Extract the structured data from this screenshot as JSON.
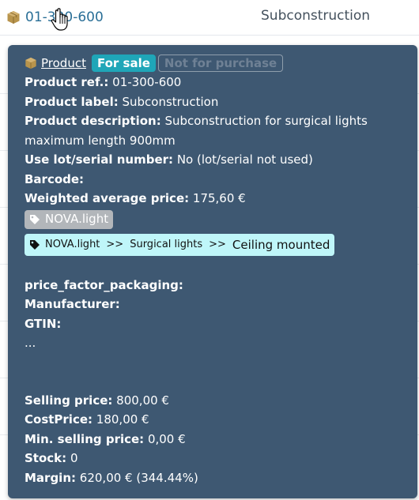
{
  "row": {
    "ref": "01-300-600",
    "label": "Subconstruction"
  },
  "tooltip": {
    "title_link": "Product",
    "badge_sale": "For sale",
    "badge_not_purchase": "Not for purchase",
    "fields": [
      {
        "k": "Product ref.:",
        "v": "01-300-600"
      },
      {
        "k": "Product label:",
        "v": "Subconstruction"
      },
      {
        "k": "Product description:",
        "v": "Subconstruction for surgical lights"
      }
    ],
    "desc_cont": "maximum length 900mm",
    "fields2": [
      {
        "k": "Use lot/serial number:",
        "v": "No (lot/serial not used)"
      },
      {
        "k": "Barcode:",
        "v": ""
      },
      {
        "k": "Weighted average price:",
        "v": "175,60 €"
      }
    ],
    "tag_grey": "NOVA.light",
    "tag_path": {
      "p1": "NOVA.light",
      "sep1": ">>",
      "p2": "Surgical lights",
      "sep2": ">>",
      "p3": "Ceiling mounted"
    },
    "extra": [
      {
        "k": "price_factor_packaging:",
        "v": ""
      },
      {
        "k": "Manufacturer:",
        "v": ""
      },
      {
        "k": "GTIN:",
        "v": ""
      }
    ],
    "ellipsis": "...",
    "prices": [
      {
        "k": "Selling price:",
        "v": "800,00 €"
      },
      {
        "k": "CostPrice:",
        "v": "180,00 €"
      },
      {
        "k": "Min. selling price:",
        "v": "0,00 €"
      },
      {
        "k": "Stock:",
        "v": "0"
      },
      {
        "k": "Margin:",
        "v": "620,00 € (344.44%)"
      }
    ]
  },
  "colors": {
    "tooltip_bg": "#3e5872",
    "link": "#2a6f97",
    "sale_badge": "#1fa6b8",
    "path_tag": "#bff6f9",
    "grey_tag": "#b2b6ba"
  },
  "icons": [
    "box-icon",
    "tag-icon",
    "hand-cursor-icon"
  ]
}
